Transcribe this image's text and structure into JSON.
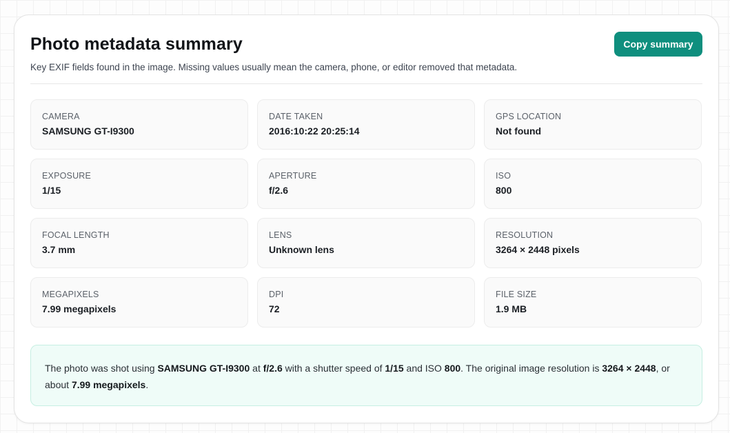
{
  "header": {
    "title": "Photo metadata summary",
    "subtitle": "Key EXIF fields found in the image. Missing values usually mean the camera, phone, or editor removed that metadata.",
    "copy_label": "Copy summary"
  },
  "fields": [
    {
      "label": "CAMERA",
      "value": "SAMSUNG GT-I9300"
    },
    {
      "label": "DATE TAKEN",
      "value": "2016:10:22 20:25:14"
    },
    {
      "label": "GPS LOCATION",
      "value": "Not found"
    },
    {
      "label": "EXPOSURE",
      "value": "1/15"
    },
    {
      "label": "APERTURE",
      "value": "f/2.6"
    },
    {
      "label": "ISO",
      "value": "800"
    },
    {
      "label": "FOCAL LENGTH",
      "value": "3.7 mm"
    },
    {
      "label": "LENS",
      "value": "Unknown lens"
    },
    {
      "label": "RESOLUTION",
      "value": "3264 × 2448 pixels"
    },
    {
      "label": "MEGAPIXELS",
      "value": "7.99 megapixels"
    },
    {
      "label": "DPI",
      "value": "72"
    },
    {
      "label": "FILE SIZE",
      "value": "1.9 MB"
    }
  ],
  "summary": {
    "t1": "The photo was shot using ",
    "camera": "SAMSUNG GT-I9300",
    "t2": " at ",
    "aperture": "f/2.6",
    "t3": " with a shutter speed of ",
    "shutter": "1/15",
    "t4": " and ISO ",
    "iso": "800",
    "t5": ". The original image resolution is ",
    "resolution": "3264 × 2448",
    "t6": ", or about ",
    "megapixels": "7.99 megapixels",
    "t7": "."
  },
  "colors": {
    "accent": "#0f8f7e",
    "summary_bg": "#effcf8",
    "summary_border": "#c6efe2"
  }
}
